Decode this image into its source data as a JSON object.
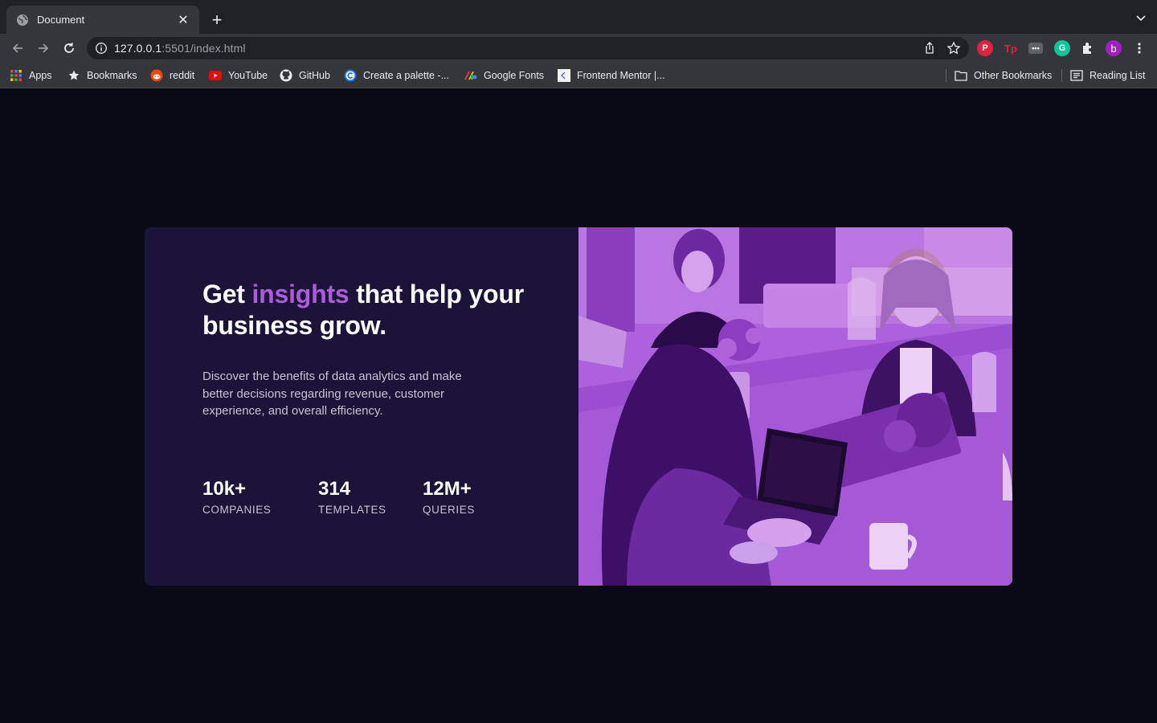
{
  "browser": {
    "tab": {
      "title": "Document",
      "favicon": "globe-icon"
    },
    "url": {
      "host": "127.0.0.1",
      "rest": ":5501/index.html"
    },
    "bookmarks": [
      {
        "label": "Apps",
        "icon": "apps-grid-icon"
      },
      {
        "label": "Bookmarks",
        "icon": "star-icon"
      },
      {
        "label": "reddit",
        "icon": "reddit-icon"
      },
      {
        "label": "YouTube",
        "icon": "youtube-icon"
      },
      {
        "label": "GitHub",
        "icon": "github-icon"
      },
      {
        "label": "Create a palette -...",
        "icon": "coolors-icon"
      },
      {
        "label": "Google Fonts",
        "icon": "google-fonts-icon"
      },
      {
        "label": "Frontend Mentor |...",
        "icon": "frontend-mentor-icon"
      }
    ],
    "bookmarks_right": [
      {
        "label": "Other Bookmarks",
        "icon": "folder-icon"
      },
      {
        "label": "Reading List",
        "icon": "reading-list-icon"
      }
    ],
    "profile_initial": "b",
    "colors": {
      "tabstrip": "#202124",
      "toolbar": "#35363a",
      "profile": "#a020c0"
    }
  },
  "page": {
    "headline": {
      "before": "Get ",
      "accent": "insights",
      "after": " that help your business grow."
    },
    "description": "Discover the benefits of data analytics and make better decisions regarding revenue, customer experience, and overall efficiency.",
    "stats": [
      {
        "value": "10k+",
        "label": "COMPANIES"
      },
      {
        "value": "314",
        "label": "TEMPLATES"
      },
      {
        "value": "12M+",
        "label": "QUERIES"
      }
    ],
    "image_alt": "People working at a table with laptops, purple overlay",
    "colors": {
      "background": "#0a0a17",
      "card": "#1c1339",
      "accent": "#ab5cdb",
      "image_overlay": "#aa5cdb"
    }
  }
}
